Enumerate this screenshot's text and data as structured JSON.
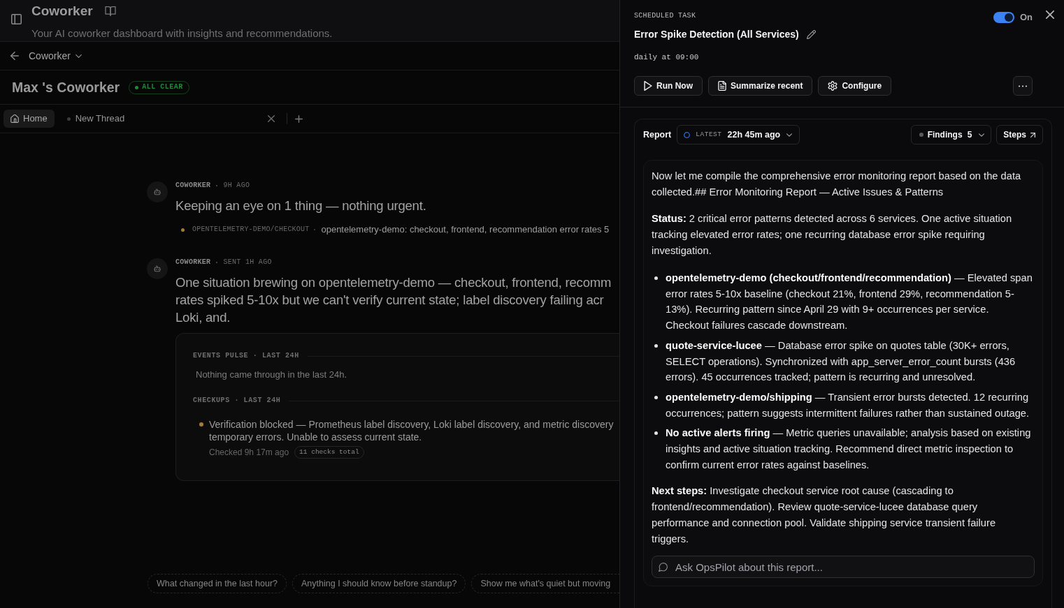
{
  "app_header": {
    "title": "Coworker",
    "subtitle": "Your AI coworker dashboard with insights and recommendations."
  },
  "breadcrumb": {
    "label": "Coworker"
  },
  "page": {
    "title": "Max 's Coworker",
    "status_badge": "ALL CLEAR"
  },
  "tabs": [
    {
      "kind": "home",
      "label": "Home",
      "selected": true
    },
    {
      "kind": "thread",
      "label": "New Thread",
      "selected": false
    }
  ],
  "messages": [
    {
      "author": "COWORKER",
      "time": "9H AGO",
      "lines": [
        "Keeping an eye on 1 thing — nothing urgent."
      ],
      "watch_items": [
        {
          "color": "#a87a32",
          "source": "OPENTELEMETRY-DEMO/CHECKOUT",
          "text": "opentelemetry-demo: checkout, frontend, recommendation error rates 5"
        }
      ]
    },
    {
      "author": "COWORKER",
      "time": "SENT 1H AGO",
      "lines": [
        "One situation brewing on opentelemetry-demo — checkout, frontend, recomm",
        "rates spiked 5-10x but we can't verify current state; label discovery failing acr",
        "Loki, and."
      ],
      "card": {
        "sections": [
          {
            "heading": "EVENTS PULSE · LAST 24H",
            "empty_text": "Nothing came through in the last 24h."
          },
          {
            "heading": "CHECKUPS · LAST 24H",
            "checkups": [
              {
                "color": "#a87a32",
                "lines": [
                  "Verification blocked — Prometheus label discovery, Loki label discovery, and metric discovery",
                  "temporary errors. Unable to assess current state."
                ],
                "checked": "Checked 9h 17m ago",
                "count": "11 checks total"
              }
            ]
          }
        ]
      }
    }
  ],
  "suggestions": [
    "What changed in the last hour?",
    "Anything I should know before standup?",
    "Show me what's quiet but moving"
  ],
  "task_panel": {
    "eyebrow": "SCHEDULED TASK",
    "enabled": true,
    "toggle_label": "On",
    "title": "Error Spike Detection (All Services)",
    "schedule": "daily at 09:00",
    "actions": [
      {
        "kind": "run",
        "label": "Run Now"
      },
      {
        "kind": "summarize",
        "label": "Summarize recent"
      },
      {
        "kind": "configure",
        "label": "Configure"
      }
    ],
    "report": {
      "title": "Report",
      "run_selector": {
        "tag": "LATEST",
        "value": "22h 45m ago"
      },
      "findings": {
        "label": "Findings",
        "count": "5"
      },
      "steps_label": "Steps",
      "blocks": [
        {
          "kind": "paragraph",
          "text": "Now let me compile the comprehensive error monitoring report based on the data collected.## Error Monitoring Report — Active Issues & Patterns"
        },
        {
          "kind": "paragraph",
          "text": "**Status:** 2 critical error patterns detected across 6 services. One active situation tracking elevated error rates; one recurring database error spike requiring investigation."
        },
        {
          "kind": "list",
          "items": [
            "**opentelemetry-demo (checkout/frontend/recommendation)** — Elevated span error rates 5-10x baseline (checkout 21%, frontend 29%, recommendation 5-13%). Recurring pattern since April 29 with 9+ occurrences per service. Checkout failures cascade downstream.",
            "**quote-service-lucee** — Database error spike on quotes table (30K+ errors, SELECT operations). Synchronized with app_server_error_count bursts (436 errors). 45 occurrences tracked; pattern is recurring and unresolved.",
            "**opentelemetry-demo/shipping** — Transient error bursts detected. 12 recurring occurrences; pattern suggests intermittent failures rather than sustained outage.",
            "**No active alerts firing** — Metric queries unavailable; analysis based on existing insights and active situation tracking. Recommend direct metric inspection to confirm current error rates against baselines."
          ]
        },
        {
          "kind": "paragraph",
          "text": "**Next steps:** Investigate checkout service root cause (cascading to frontend/recommendation). Review quote-service-lucee database query performance and connection pool. Validate shipping service transient failure triggers."
        }
      ],
      "ask_placeholder": "Ask OpsPilot about this report..."
    }
  }
}
